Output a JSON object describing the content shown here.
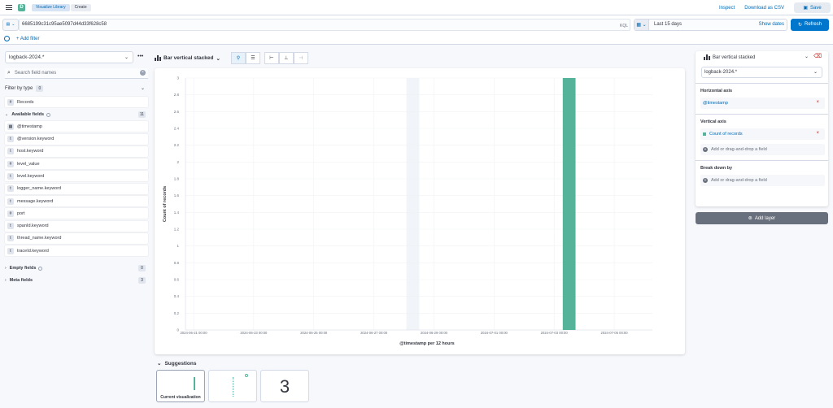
{
  "topbar": {
    "logo_letter": "D",
    "breadcrumbs": [
      "Visualize Library",
      "Create"
    ],
    "links": [
      "Inspect",
      "Download as CSV"
    ],
    "save_label": "Save"
  },
  "query": {
    "value": "6685199c31c95ae5097d44d33f628c58",
    "lang": "KQL",
    "date_range": "Last 15 days",
    "show_dates": "Show dates",
    "refresh_label": "Refresh",
    "add_filter": "+ Add filter"
  },
  "left": {
    "data_view": "logback-2024.*",
    "search_placeholder": "Search field names",
    "filter_by_type": "Filter by type",
    "filter_count": "0",
    "records": "Records",
    "available_label": "Available fields",
    "available_count": "11",
    "fields": [
      {
        "type": "date",
        "name": "@timestamp"
      },
      {
        "type": "t",
        "name": "@version.keyword"
      },
      {
        "type": "t",
        "name": "host.keyword"
      },
      {
        "type": "#",
        "name": "level_value"
      },
      {
        "type": "t",
        "name": "level.keyword"
      },
      {
        "type": "t",
        "name": "logger_name.keyword"
      },
      {
        "type": "t",
        "name": "message.keyword"
      },
      {
        "type": "#",
        "name": "port"
      },
      {
        "type": "t",
        "name": "spanId.keyword"
      },
      {
        "type": "t",
        "name": "thread_name.keyword"
      },
      {
        "type": "t",
        "name": "traceId.keyword"
      }
    ],
    "empty_label": "Empty fields",
    "empty_count": "0",
    "meta_label": "Meta fields",
    "meta_count": "3"
  },
  "workspace": {
    "chart_type": "Bar vertical stacked",
    "suggestions_label": "Suggestions",
    "current_viz": "Current visualization",
    "metric_suggestion": "3"
  },
  "config": {
    "chart_type": "Bar vertical stacked",
    "data_view": "logback-2024.*",
    "horizontal_axis_label": "Horizontal axis",
    "horizontal_field": "@timestamp",
    "vertical_axis_label": "Vertical axis",
    "vertical_field": "Count of records",
    "add_field": "Add or drag-and-drop a field",
    "breakdown_label": "Break down by",
    "add_layer": "Add layer"
  },
  "colors": {
    "accent": "#0077cc",
    "bar": "#54b399"
  },
  "chart_data": {
    "type": "bar",
    "xlabel": "@timestamp per 12 hours",
    "ylabel": "Count of records",
    "ylim": [
      0,
      3
    ],
    "y_ticks": [
      "0",
      "0.2",
      "0.4",
      "0.6",
      "0.8",
      "1",
      "1.2",
      "1.4",
      "1.6",
      "1.8",
      "2",
      "2.2",
      "2.4",
      "2.6",
      "2.8",
      "3"
    ],
    "x_ticks": [
      "2024-06-21 00:00",
      "2024-06-23 00:00",
      "2024-06-25 00:00",
      "2024-06-27 00:00",
      "2024-06-29 00:00",
      "2024-07-01 00:00",
      "2024-07-03 00:00",
      "2024-07-05 00:00"
    ],
    "x_range_days": [
      0,
      15
    ],
    "bars": [
      {
        "x": "2024-07-03 12:00",
        "value": 3
      }
    ],
    "grid": true
  }
}
